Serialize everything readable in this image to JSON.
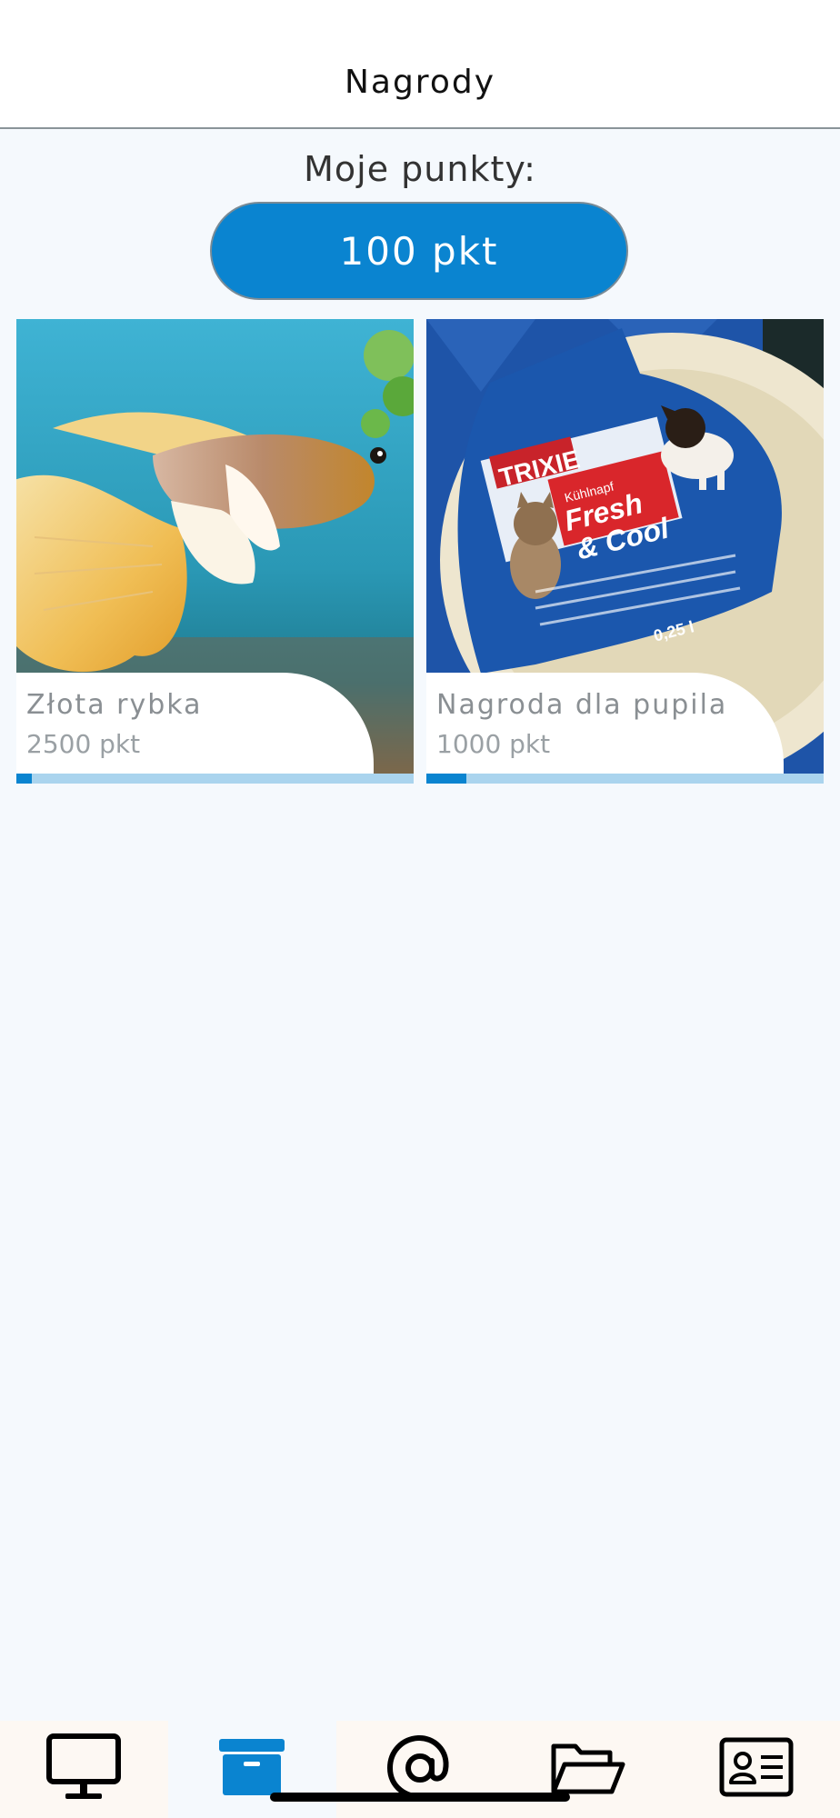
{
  "header": {
    "title": "Nagrody"
  },
  "points": {
    "label": "Moje punkty:",
    "value": "100 pkt",
    "current": 100
  },
  "rewards": [
    {
      "name": "Złota rybka",
      "points_label": "2500 pkt",
      "cost": 2500,
      "progress": 0.04,
      "image": "betta-fish-photo"
    },
    {
      "name": "Nagroda dla pupila",
      "points_label": "1000 pkt",
      "cost": 1000,
      "progress": 0.1,
      "image": "pet-bowl-photo"
    }
  ],
  "product_label": {
    "brand": "TRIXIE",
    "line1": "Kühlnapf",
    "line2": "Fresh",
    "line3": "& Cool",
    "volume": "0,25 l"
  },
  "nav": [
    {
      "icon": "monitor-icon",
      "active": false
    },
    {
      "icon": "archive-box-icon",
      "active": true
    },
    {
      "icon": "at-sign-icon",
      "active": false
    },
    {
      "icon": "folder-open-icon",
      "active": false
    },
    {
      "icon": "id-card-icon",
      "active": false
    }
  ],
  "colors": {
    "accent": "#0a84d0",
    "progress_track": "#aad4ee",
    "background": "#f5f9fd"
  }
}
